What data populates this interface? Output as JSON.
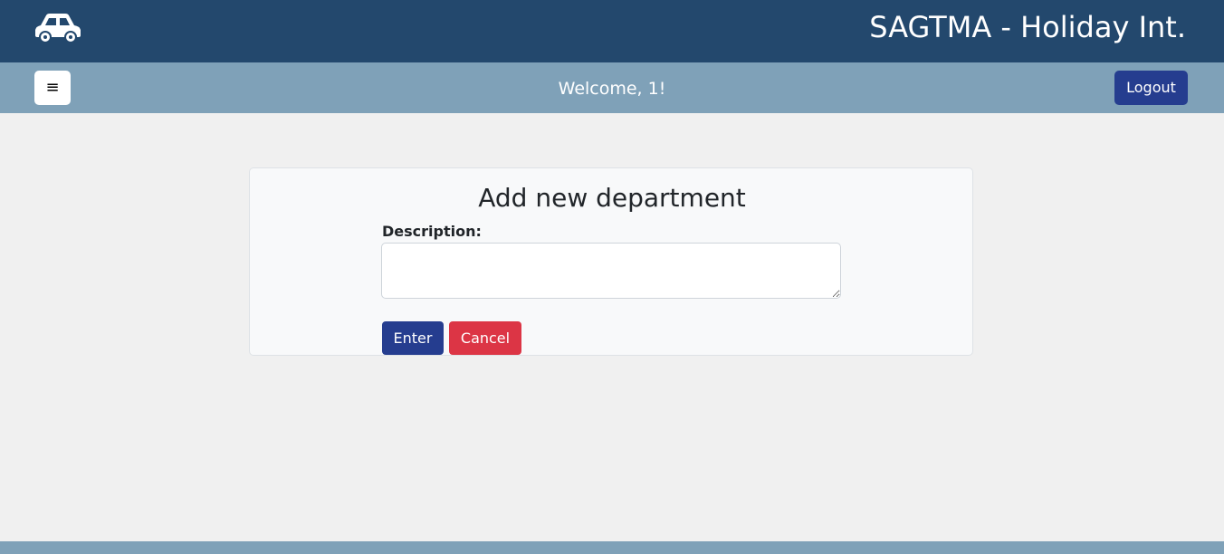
{
  "header": {
    "logo_icon": "car-icon",
    "title": "SAGTMA - Holiday Int."
  },
  "subbar": {
    "menu_icon": "≡",
    "welcome": "Welcome, 1!",
    "logout_label": "Logout"
  },
  "form": {
    "title": "Add new department",
    "description_label": "Description:",
    "description_value": "",
    "enter_label": "Enter",
    "cancel_label": "Cancel"
  },
  "colors": {
    "header_bg": "#23486d",
    "subbar_bg": "#7fa1b8",
    "primary": "#253d8f",
    "danger": "#dc3545"
  }
}
